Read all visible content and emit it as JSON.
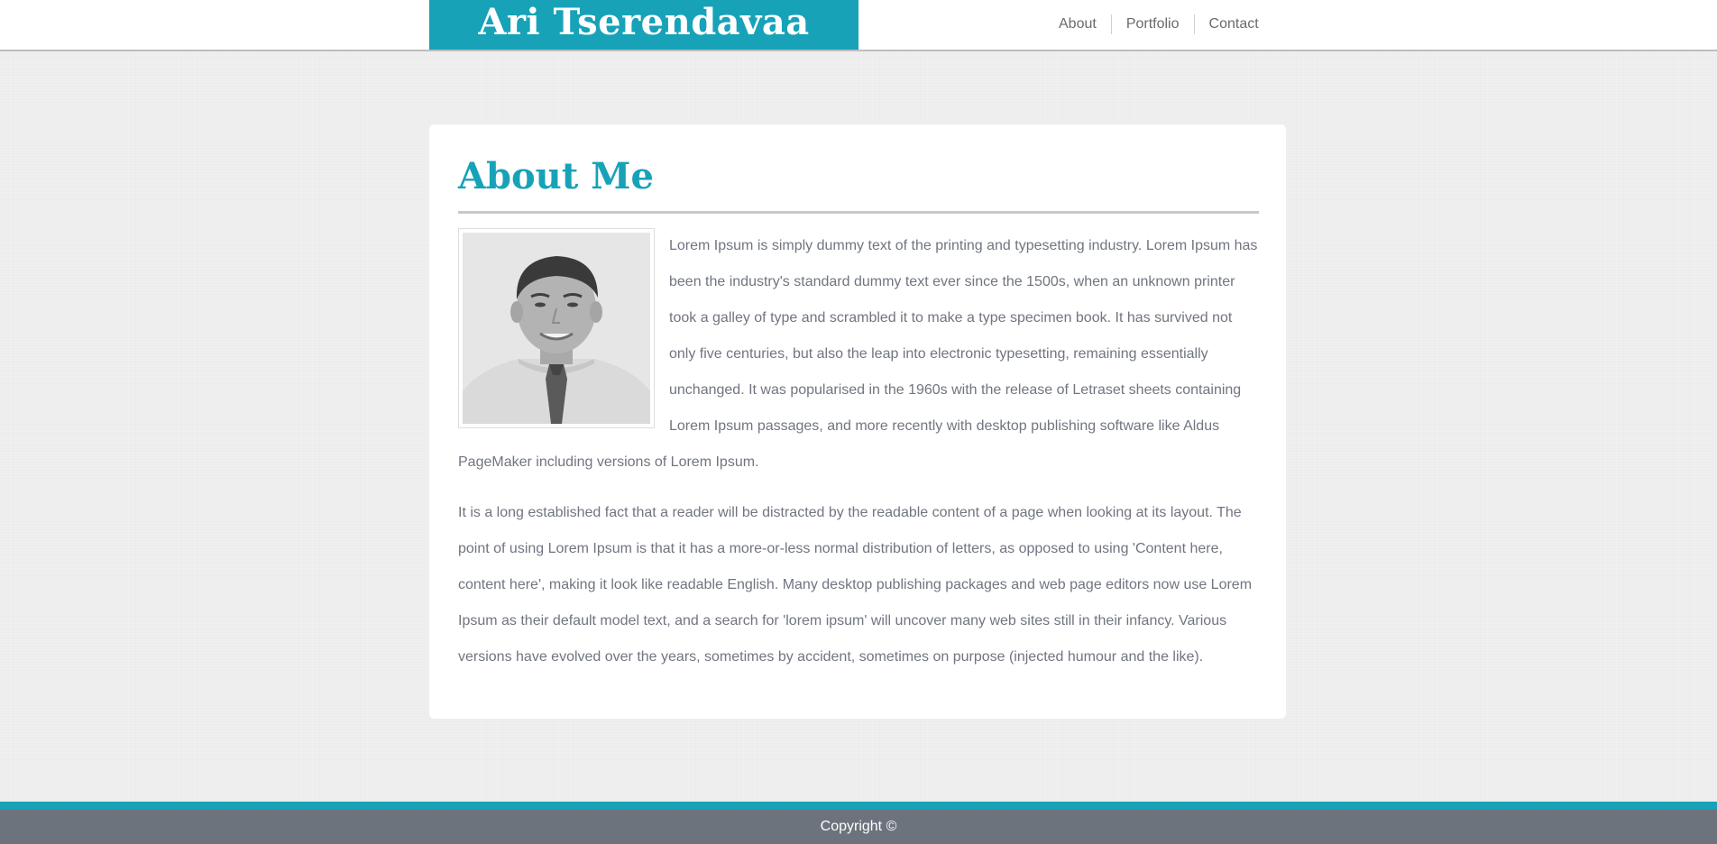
{
  "header": {
    "brand": "Ari Tserendavaa",
    "nav": [
      "About",
      "Portfolio",
      "Contact"
    ]
  },
  "main": {
    "title": "About Me",
    "paragraphs": [
      "Lorem Ipsum is simply dummy text of the printing and typesetting industry. Lorem Ipsum has been the industry's standard dummy text ever since the 1500s, when an unknown printer took a galley of type and scrambled it to make a type specimen book. It has survived not only five centuries, but also the leap into electronic typesetting, remaining essentially unchanged. It was popularised in the 1960s with the release of Letraset sheets containing Lorem Ipsum passages, and more recently with desktop publishing software like Aldus PageMaker including versions of Lorem Ipsum.",
      "It is a long established fact that a reader will be distracted by the readable content of a page when looking at its layout. The point of using Lorem Ipsum is that it has a more-or-less normal distribution of letters, as opposed to using 'Content here, content here', making it look like readable English. Many desktop publishing packages and web page editors now use Lorem Ipsum as their default model text, and a search for 'lorem ipsum' will uncover many web sites still in their infancy. Various versions have evolved over the years, sometimes by accident, sometimes on purpose (injected humour and the like)."
    ]
  },
  "footer": {
    "copyright": "Copyright ©"
  },
  "colors": {
    "accent": "#17a2b8",
    "footer_bg": "#6c737d",
    "body_text": "#707580",
    "nav_text": "#6b6b6b"
  }
}
